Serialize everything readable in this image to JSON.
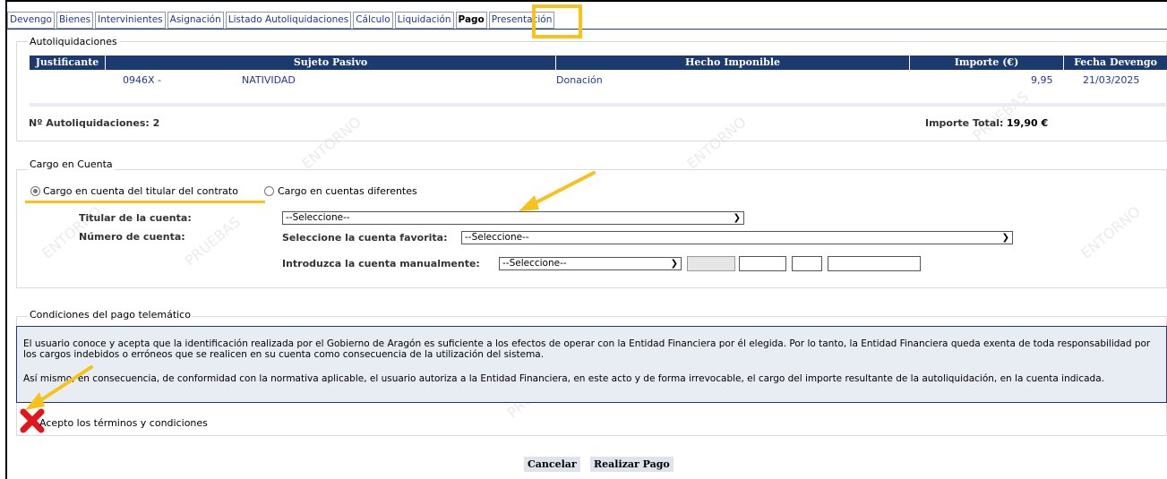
{
  "tabs": [
    "Devengo",
    "Bienes",
    "Intervinientes",
    "Asignación",
    "Listado Autoliquidaciones",
    "Cálculo",
    "Liquidación",
    "Pago",
    "Presentación"
  ],
  "active_tab": "Pago",
  "autoliquidaciones": {
    "legend": "Autoliquidaciones",
    "columns": [
      "Justificante",
      "Sujeto Pasivo",
      "Hecho Imponible",
      "Importe (€)",
      "Fecha Devengo"
    ],
    "rows": [
      {
        "justificante": "0946X -",
        "sujeto": "NATIVIDAD",
        "hecho": "Donación",
        "importe": "9,95",
        "fecha": "21/03/2025"
      }
    ],
    "count_label": "Nº Autoliquidaciones: 2",
    "total_label": "Importe Total:",
    "total_value": "19,90 €"
  },
  "cargo": {
    "legend": "Cargo en Cuenta",
    "option_titular": "Cargo en cuenta del titular del contrato",
    "option_diferentes": "Cargo en cuentas diferentes",
    "titular_label": "Titular de la cuenta:",
    "numero_label": "Número de cuenta:",
    "titular_select": "--Seleccione--",
    "favorita_label": "Seleccione la cuenta favorita:",
    "favorita_select": "--Seleccione--",
    "manual_label": "Introduzca la cuenta manualmente:",
    "manual_select": "--Seleccione--"
  },
  "condiciones": {
    "legend": "Condiciones del pago telemático",
    "paragraph1": "El usuario conoce y acepta que la identificación realizada por el Gobierno de Aragón es suficiente a los efectos de operar con la Entidad Financiera por él elegida. Por lo tanto, la Entidad Financiera queda exenta de toda responsabilidad por los cargos indebidos o erróneos que se realicen en su cuenta como consecuencia de la utilización del sistema.",
    "paragraph2": "Así mismo, en consecuencia, de conformidad con la normativa aplicable, el usuario autoriza a la Entidad Financiera, en este acto y de forma irrevocable, el cargo del importe resultante de la autoliquidación, en la cuenta indicada.",
    "accept_label": "Acepto los términos y condiciones"
  },
  "buttons": {
    "cancel": "Cancelar",
    "pay": "Realizar Pago"
  },
  "colors": {
    "header_bg": "#1c3a6e",
    "link": "#1f3a93",
    "highlight": "#f7c31a",
    "cross": "#e3141b"
  }
}
